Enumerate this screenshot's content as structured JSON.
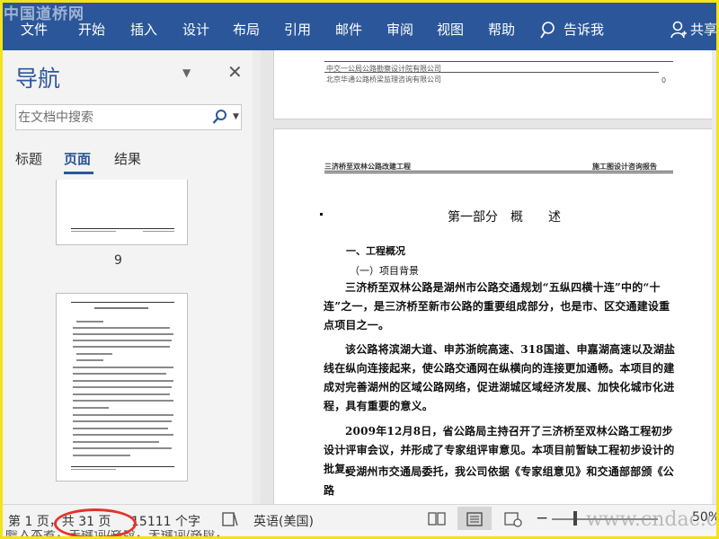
{
  "ribbon": {
    "watermark": "中国道桥网",
    "tabs": [
      "文件",
      "开始",
      "插入",
      "设计",
      "布局",
      "引用",
      "邮件",
      "审阅",
      "视图",
      "帮助"
    ],
    "tell_me": "告诉我",
    "share": "共享",
    "color": "#2b579a"
  },
  "nav": {
    "title": "导航",
    "search_placeholder": "在文档中搜索",
    "tabs": [
      "标题",
      "页面",
      "结果"
    ],
    "active_tab": "页面",
    "page_number": "9"
  },
  "doc": {
    "page1_header_lines": [
      "中交一公局公路勘察设计院有限公司",
      "北京华通公路桥梁监理咨询有限公司"
    ],
    "page1_page_no": "0",
    "header_left": "三济桥至双林公路改建工程",
    "header_right": "施工图设计咨询报告",
    "heading": "第一部分　概　　述",
    "section1": "一、工程概况",
    "section1_sub": "（一）项目背景",
    "paragraphs": [
      "三济桥至双林公路是湖州市公路交通规划“五纵四横十连”中的“十连”之一，是三济桥至新市公路的重要组成部分，也是市、区交通建设重点项目之一。",
      "该公路将滨湖大道、申苏浙皖高速、318国道、申嘉湖高速以及湖盐线在纵向连接起来，使公路交通网在纵横向的连接更加通畅。本项目的建成对完善湖州的区域公路网络，促进湖城区域经济发展、加快化城市化进程，具有重要的意义。",
      "2009年12月8日，省公路局主持召开了三济桥至双林公路工程初步设计评审会议，并形成了专家组评审意见。本项目前暂缺工程初步设计的批复。",
      "受湖州市交通局委托，我公司依据《专家组意见》和交通部部颁《公路"
    ]
  },
  "status": {
    "page": "第 1 页，共 31 页",
    "words": "15111 个字",
    "language": "英语(美国)",
    "zoom": "50%",
    "watermark": "www.cndac.com"
  },
  "bottom_strip": "瞻入本者，关键词/路段，关键词/路段，",
  "highlight_color": "#e5332a"
}
